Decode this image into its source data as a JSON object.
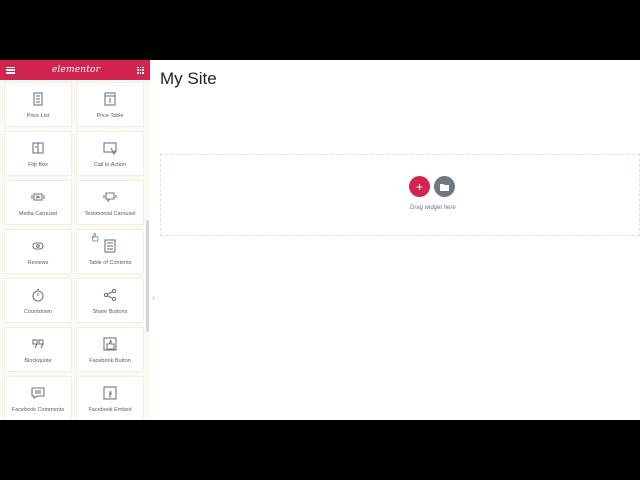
{
  "sidebar": {
    "logo": "elementor",
    "widgets": [
      {
        "label": "Price List",
        "icon": "price-list-icon"
      },
      {
        "label": "Price Table",
        "icon": "price-table-icon"
      },
      {
        "label": "Flip Box",
        "icon": "flip-box-icon"
      },
      {
        "label": "Call to Action",
        "icon": "call-to-action-icon"
      },
      {
        "label": "Media Carousel",
        "icon": "media-carousel-icon"
      },
      {
        "label": "Testimonial Carousel",
        "icon": "testimonial-carousel-icon"
      },
      {
        "label": "Reviews",
        "icon": "reviews-icon"
      },
      {
        "label": "Table of Contents",
        "icon": "table-of-contents-icon"
      },
      {
        "label": "Countdown",
        "icon": "countdown-icon"
      },
      {
        "label": "Share Buttons",
        "icon": "share-buttons-icon"
      },
      {
        "label": "Blockquote",
        "icon": "blockquote-icon"
      },
      {
        "label": "Facebook Button",
        "icon": "facebook-button-icon"
      },
      {
        "label": "Facebook Comments",
        "icon": "facebook-comments-icon"
      },
      {
        "label": "Facebook Embed",
        "icon": "facebook-embed-icon"
      }
    ]
  },
  "canvas": {
    "site_title": "My Site",
    "add_button": "+",
    "drag_text": "Drag widget here"
  },
  "colors": {
    "brand": "#d1254f",
    "icon_gray": "#6d7882"
  }
}
